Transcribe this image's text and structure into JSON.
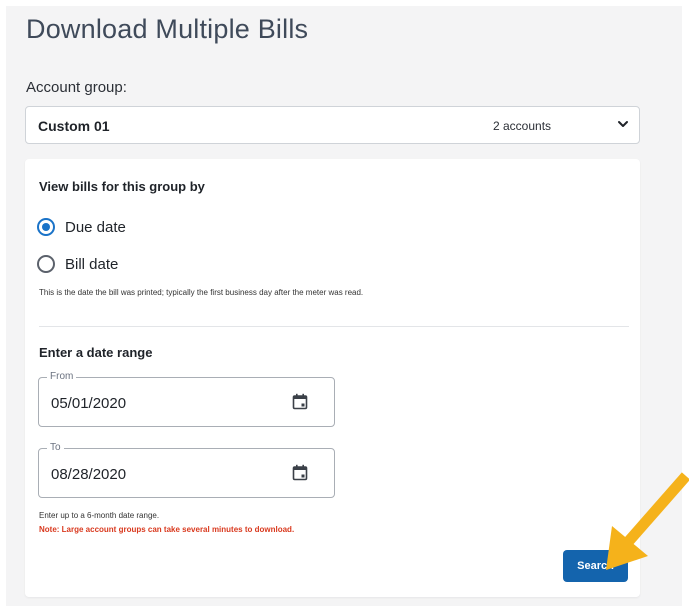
{
  "page": {
    "title": "Download Multiple Bills"
  },
  "account_group": {
    "label": "Account group:",
    "selected_name": "Custom 01",
    "count_text": "2 accounts",
    "chevron_icon": "chevron-down-icon"
  },
  "view_by": {
    "heading": "View bills for this group by",
    "options": [
      {
        "label": "Due date",
        "checked": true
      },
      {
        "label": "Bill date",
        "checked": false
      }
    ],
    "helper_text": "This is the date the bill was printed; typically the first business day after the meter was read."
  },
  "date_range": {
    "heading": "Enter a date range",
    "from": {
      "legend": "From",
      "value": "05/01/2020",
      "icon": "calendar-icon"
    },
    "to": {
      "legend": "To",
      "value": "08/28/2020",
      "icon": "calendar-icon"
    },
    "hint": "Enter up to a 6-month date range.",
    "warning": "Note: Large account groups can take several minutes to download."
  },
  "actions": {
    "search_label": "Search"
  },
  "colors": {
    "primary": "#1464ad",
    "radio_accent": "#1a73c8",
    "warning": "#d9391e",
    "annotation_arrow": "#f5b21b"
  }
}
